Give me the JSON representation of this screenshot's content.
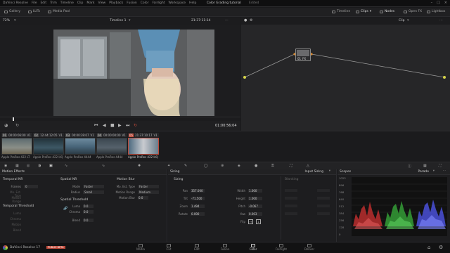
{
  "titlebar": {
    "app_menu": [
      "DaVinci Resolve",
      "File",
      "Edit",
      "Trim",
      "Timeline",
      "Clip",
      "Mark",
      "View",
      "Playback",
      "Fusion",
      "Color",
      "Fairlight",
      "Workspace",
      "Help"
    ],
    "project_title": "Color Grading tutorial",
    "project_status": "Edited"
  },
  "toolbar": {
    "gallery": "Gallery",
    "luts": "LUTs",
    "media_pool": "Media Pool",
    "timeline": "Timeline",
    "clips": "Clips",
    "nodes": "Nodes",
    "open_fx": "Open FX",
    "lightbox": "Lightbox"
  },
  "viewer": {
    "zoom": "72%",
    "timeline_name": "Timeline 1",
    "timecode_top": "21:37:11:14",
    "timecode_current": "01:00:56:04"
  },
  "nodes": {
    "mode": "Clip",
    "node_label": "01",
    "node_title": "FX"
  },
  "clips": [
    {
      "num": "01",
      "tc": "00:00:06:00",
      "track": "V1",
      "label": "Apple ProRes 422 LT",
      "sel": false
    },
    {
      "num": "02",
      "tc": "12:44:12:05",
      "track": "V1",
      "label": "Apple ProRes 422 HQ",
      "sel": false
    },
    {
      "num": "03",
      "tc": "00:00:39:07",
      "track": "V1",
      "label": "Apple ProRes 4444",
      "sel": false
    },
    {
      "num": "04",
      "tc": "00:00:00:00",
      "track": "V1",
      "label": "Apple ProRes 4444",
      "sel": false
    },
    {
      "num": "05",
      "tc": "21:37:10:17",
      "track": "V1",
      "label": "Apple ProRes 422 HQ",
      "sel": true
    }
  ],
  "motion_effects": {
    "title": "Motion Effects",
    "temporal_nr": "Temporal NR",
    "frames_label": "Frames",
    "frames_value": "0",
    "mo_est_label": "Mo. Est. Type",
    "motion_range_label": "Motion Range",
    "temporal_threshold": "Temporal Threshold",
    "luma_label": "Luma",
    "chroma_label": "Chroma",
    "motion_label": "Motion",
    "blend_label": "Blend",
    "spatial_nr": "Spatial NR",
    "mode_label": "Mode",
    "mode_value": "Faster",
    "radius_label": "Radius",
    "radius_value": "Small",
    "spatial_threshold": "Spatial Threshold",
    "sp_luma_value": "0.0",
    "sp_chroma_value": "0.0",
    "sp_blend_value": "0.0",
    "motion_blur": "Motion Blur",
    "mb_mo_est_label": "Mo. Est. Type",
    "mb_mo_est_value": "Faster",
    "mb_motion_range_label": "Motion Range",
    "mb_motion_range_value": "Medium",
    "mb_motion_blur_label": "Motion Blur",
    "mb_motion_blur_value": "0.0"
  },
  "sizing": {
    "title": "Sizing",
    "mode": "Input Sizing",
    "section": "Sizing",
    "pan_label": "Pan",
    "pan_value": "357.000",
    "tilt_label": "Tilt",
    "tilt_value": "-71.500",
    "zoom_label": "Zoom",
    "zoom_value": "1.494",
    "rotate_label": "Rotate",
    "rotate_value": "0.000",
    "width_label": "Width",
    "width_value": "1.000",
    "height_label": "Height",
    "height_value": "1.000",
    "pitch_label": "Pitch",
    "pitch_value": "-0.067",
    "yaw_label": "Yaw",
    "yaw_value": "0.003",
    "flip_label": "Flip",
    "blanking": "Blanking"
  },
  "scopes": {
    "title": "Scopes",
    "mode": "Parade",
    "ticks": [
      "1023",
      "896",
      "768",
      "640",
      "512",
      "384",
      "256",
      "128",
      "0"
    ]
  },
  "bottom": {
    "app_name": "DaVinci Resolve 17",
    "badge": "PUBLIC BETA",
    "pages": [
      "Media",
      "Cut",
      "Edit",
      "Fusion",
      "Color",
      "Fairlight",
      "Deliver"
    ],
    "active_page": "Color"
  },
  "colors": {
    "accent_red": "#c04a3a",
    "node_orange": "#d98a2e",
    "node_yellow": "#d7d44a"
  }
}
